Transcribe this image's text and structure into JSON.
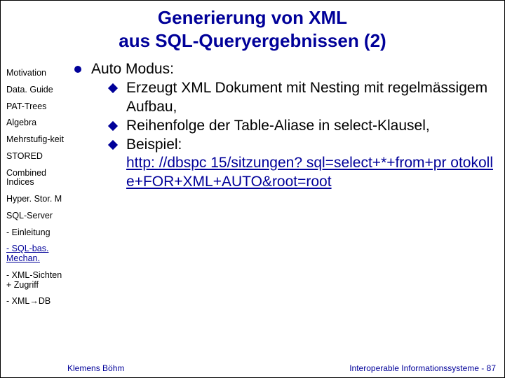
{
  "title_line1": "Generierung von XML",
  "title_line2": "aus SQL-Queryergebnissen (2)",
  "sidebar": [
    {
      "label": "Motivation",
      "link": false
    },
    {
      "label": "Data. Guide",
      "link": false
    },
    {
      "label": "PAT-Trees",
      "link": false
    },
    {
      "label": "Algebra",
      "link": false
    },
    {
      "label": "Mehrstufig-keit",
      "link": false
    },
    {
      "label": "STORED",
      "link": false
    },
    {
      "label": "Combined Indices",
      "link": false
    },
    {
      "label": "Hyper. Stor. M",
      "link": false
    },
    {
      "label": "SQL-Server",
      "link": false
    },
    {
      "label": "- Einleitung",
      "link": false
    },
    {
      "label": "- SQL-bas. Mechan.",
      "link": true
    },
    {
      "label": "- XML-Sichten + Zugriff",
      "link": false
    },
    {
      "label": "- XML→DB",
      "link": false
    }
  ],
  "main": {
    "heading": "Auto Modus:",
    "items": [
      {
        "text": "Erzeugt XML Dokument mit Nesting mit regelmässigem Aufbau,"
      },
      {
        "text": "Reihenfolge der Table-Aliase in select-Klausel,"
      },
      {
        "text": "Beispiel:",
        "link": "http: //dbspc 15/sitzungen? sql=select+*+from+pr otokolle+FOR+XML+AUTO&root=root"
      }
    ]
  },
  "footer": {
    "left": "Klemens Böhm",
    "right": "Interoperable Informationssysteme - 87"
  }
}
